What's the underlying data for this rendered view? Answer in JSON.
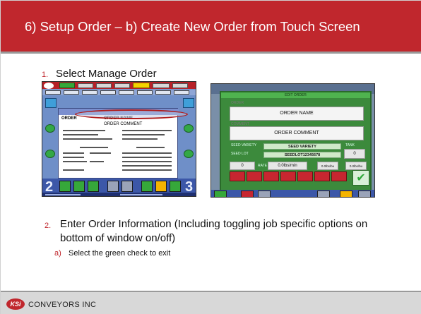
{
  "slide": {
    "title": "6) Setup Order – b) Create New Order from Touch Screen"
  },
  "steps": [
    {
      "number": "1.",
      "text": "Select Manage Order"
    },
    {
      "number": "2.",
      "text": "Enter Order Information (Including toggling job specific options on bottom of window on/off)"
    }
  ],
  "substeps": [
    {
      "letter": "a)",
      "text": "Select the green check to exit"
    }
  ],
  "screenshot_left": {
    "order_label": "ORDER",
    "order_name": "ORDER NAME",
    "order_comment": "ORDER COMMENT",
    "big_left": "2",
    "big_right": "3"
  },
  "screenshot_right": {
    "dialog_title": "EDIT ORDER",
    "order_label": "ORDER",
    "order_name": "ORDER NAME",
    "comment_label": "COMMENT",
    "order_comment": "ORDER COMMENT",
    "seed_variety_label": "SEED VARIETY",
    "seed_variety": "SEED VARIETY",
    "seed_lot_label": "SEED LOT",
    "seed_lot": "SEEDLOT12345678",
    "tank_label": "TANK",
    "tank_value": "0",
    "field_zero": "0",
    "rate_label": "RATE",
    "rate_value": "0.0lbs/min",
    "field_a": "0.0lbs/bu",
    "field_b": "0.0lbs/bu"
  },
  "footer": {
    "logo_text": "KSi",
    "brand": "CONVEYORS INC"
  },
  "colors": {
    "brand_red": "#c0272d",
    "check_green": "#2ea83a"
  }
}
